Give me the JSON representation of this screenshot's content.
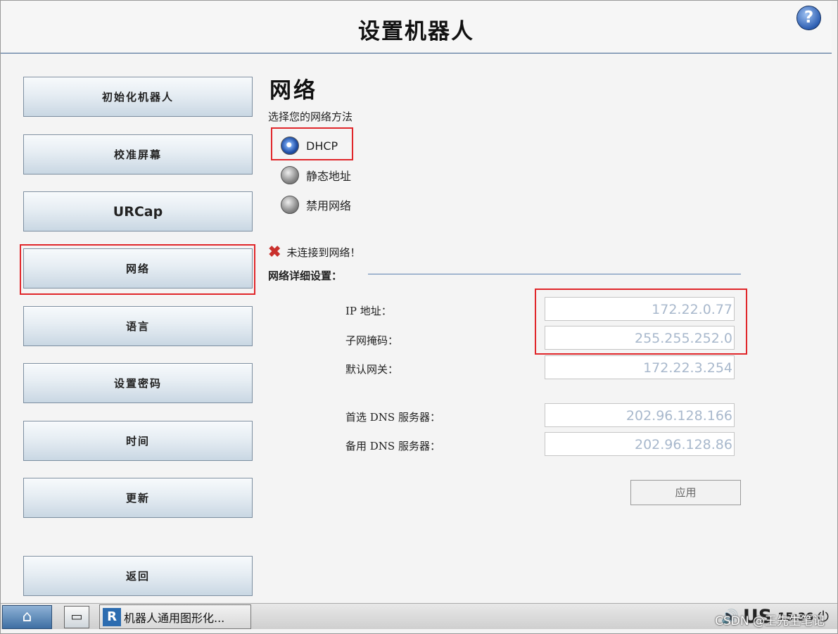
{
  "header": {
    "title": "设置机器人",
    "help_symbol": "?"
  },
  "sidebar": {
    "items": [
      {
        "label": "初始化机器人"
      },
      {
        "label": "校准屏幕"
      },
      {
        "label": "URCap"
      },
      {
        "label": "网络",
        "selected": true
      },
      {
        "label": "语言"
      },
      {
        "label": "设置密码"
      },
      {
        "label": "时间"
      },
      {
        "label": "更新"
      }
    ],
    "back_label": "返回"
  },
  "network": {
    "title": "网络",
    "method_prompt": "选择您的网络方法",
    "methods": [
      {
        "label": "DHCP",
        "selected": true
      },
      {
        "label": "静态地址",
        "selected": false
      },
      {
        "label": "禁用网络",
        "selected": false
      }
    ],
    "status_icon": "x-error-icon",
    "status_text": "未连接到网络！",
    "details_label": "网络详细设置：",
    "fields": [
      {
        "label": "IP 地址：",
        "value": "172.22.0.77"
      },
      {
        "label": "子网掩码：",
        "value": "255.255.252.0"
      },
      {
        "label": "默认网关：",
        "value": "172.22.3.254"
      },
      {
        "label": "首选 DNS 服务器：",
        "value": "202.96.128.166"
      },
      {
        "label": "备用 DNS 服务器：",
        "value": "202.96.128.86"
      }
    ],
    "apply_label": "应用"
  },
  "taskbar": {
    "app_icon_text": "R",
    "app_title": "机器人通用图形化...",
    "keyboard_layout": "US",
    "time": "15:36",
    "watermark": "CSDN @王先生笔记"
  },
  "colors": {
    "highlight": "#e0262a",
    "field_text": "#a8b8cc",
    "accent": "#2e5fb2"
  }
}
